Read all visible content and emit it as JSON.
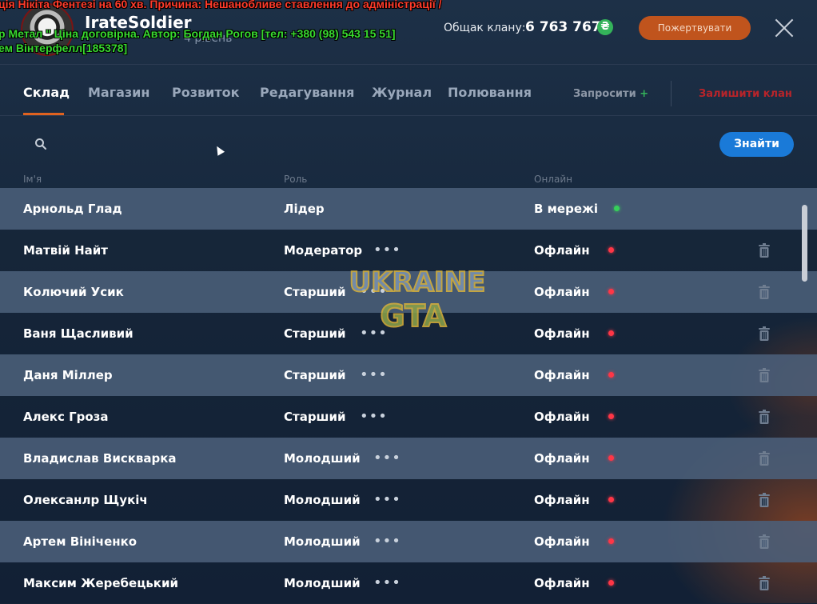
{
  "header": {
    "clan_name": "IrateSoldier",
    "clan_level": "4 рівень",
    "balance_label": "Общак клану:",
    "balance_value": "6 763 767",
    "currency_symbol": "₴",
    "donate_label": "Пожертвувати"
  },
  "chat_overlay": [
    "ція Нікіта Фентезі на 60 хв. Причина: Нешанобливе ставлення до адміністрації /",
    "р Метал \" Ціна договірна. Автор: Богдан Рогов [тел: +380 (98) 543 15 51]",
    "ем Вінтерфелл[185378]"
  ],
  "tabs": [
    {
      "label": "Склад",
      "active": true
    },
    {
      "label": "Магазин",
      "active": false
    },
    {
      "label": "Розвиток",
      "active": false
    },
    {
      "label": "Редагування",
      "active": false
    },
    {
      "label": "Журнал",
      "active": false
    },
    {
      "label": "Полювання",
      "active": false
    }
  ],
  "actions": {
    "invite_label": "Запросити",
    "invite_plus": "+",
    "leave_label": "Залишити клан"
  },
  "search": {
    "placeholder": "",
    "button_label": "Знайти"
  },
  "table": {
    "columns": [
      "Ім'я",
      "Роль",
      "Онлайн"
    ],
    "rows": [
      {
        "name": "Арнольд Глад",
        "role": "Лідер",
        "status": "В мережі",
        "online": true,
        "menu": false,
        "delete": false
      },
      {
        "name": "Матвій Найт",
        "role": "Модератор",
        "status": "Офлайн",
        "online": false,
        "menu": true,
        "delete": true
      },
      {
        "name": "Колючий Усик",
        "role": "Старший",
        "status": "Офлайн",
        "online": false,
        "menu": true,
        "delete": true
      },
      {
        "name": "Ваня Щасливий",
        "role": "Старший",
        "status": "Офлайн",
        "online": false,
        "menu": true,
        "delete": true
      },
      {
        "name": "Даня Міллер",
        "role": "Старший",
        "status": "Офлайн",
        "online": false,
        "menu": true,
        "delete": true
      },
      {
        "name": "Алекс Гроза",
        "role": "Старший",
        "status": "Офлайн",
        "online": false,
        "menu": true,
        "delete": true
      },
      {
        "name": "Владислав Вискварка",
        "role": "Молодший",
        "status": "Офлайн",
        "online": false,
        "menu": true,
        "delete": true
      },
      {
        "name": "Олексанлр Щукіч",
        "role": "Молодший",
        "status": "Офлайн",
        "online": false,
        "menu": true,
        "delete": true
      },
      {
        "name": "Артем Вініченко",
        "role": "Молодший",
        "status": "Офлайн",
        "online": false,
        "menu": true,
        "delete": true
      },
      {
        "name": "Максим Жеребецький",
        "role": "Молодший",
        "status": "Офлайн",
        "online": false,
        "menu": true,
        "delete": true
      }
    ]
  },
  "watermark": {
    "line1": "UKRAINE",
    "line2": "GTA"
  },
  "colors": {
    "accent": "#e0621f",
    "donate": "#c0541d",
    "find_button": "#1a7ad8",
    "online_dot": "#36d05a",
    "offline_dot": "#ff3646",
    "leave": "#b8242a"
  }
}
